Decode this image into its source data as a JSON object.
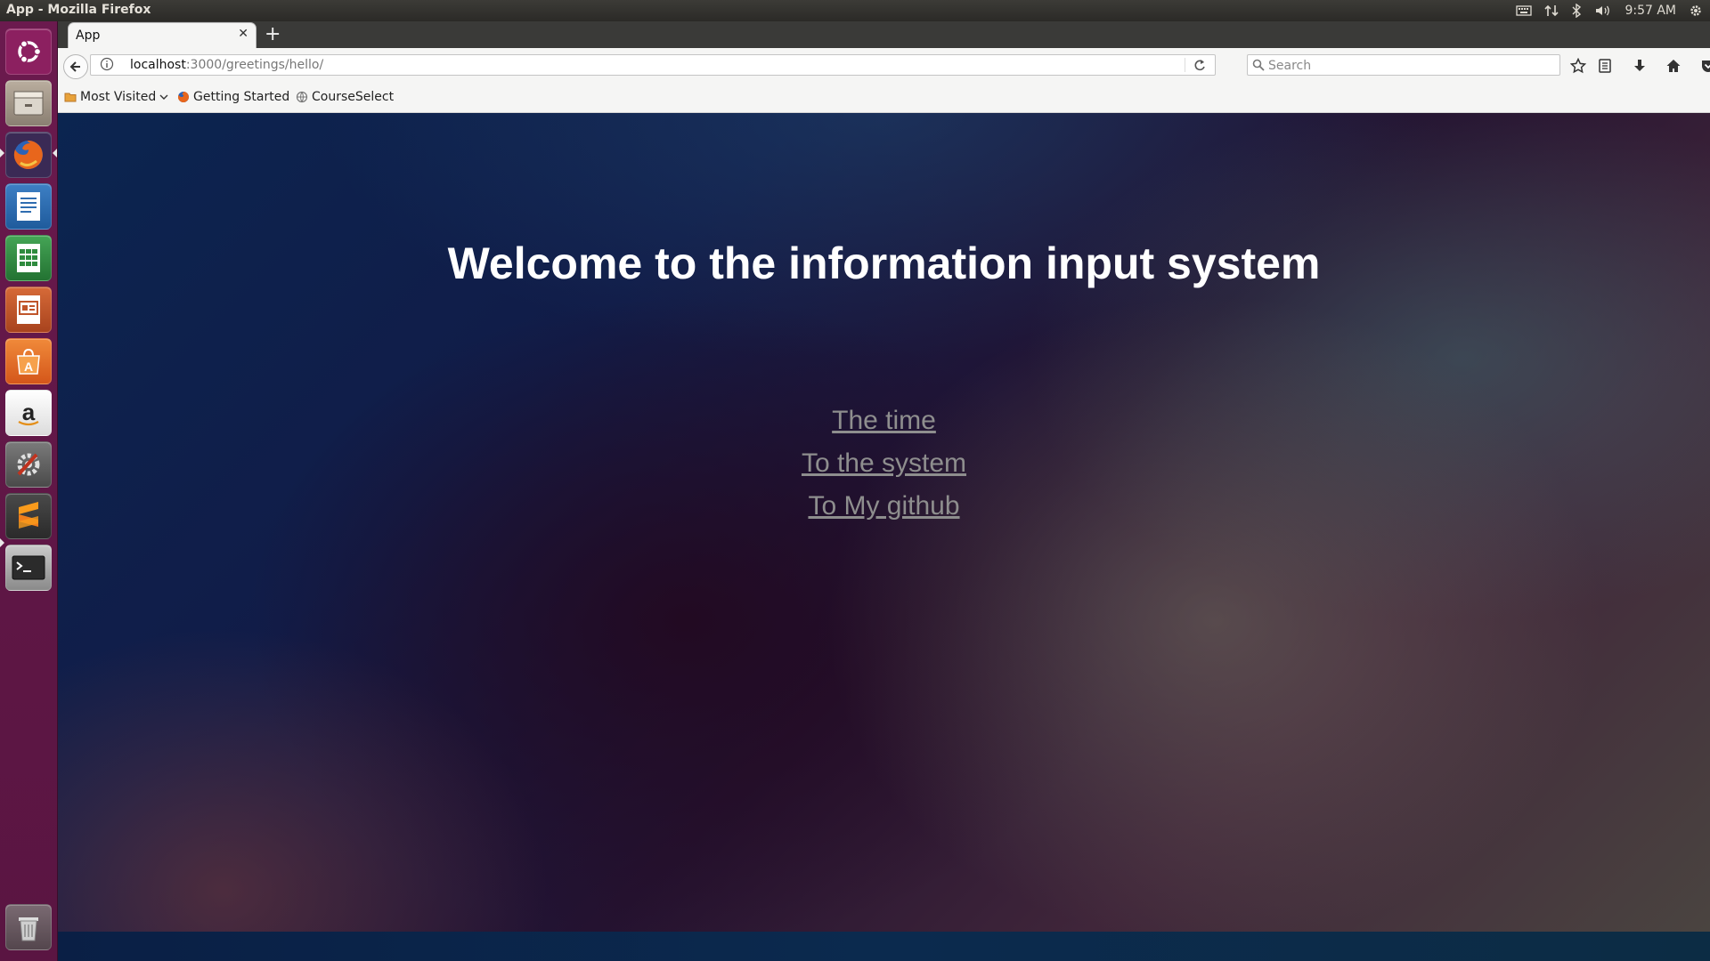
{
  "panel": {
    "window_title": "App - Mozilla Firefox",
    "clock": "9:57 AM"
  },
  "launcher": {
    "items": [
      {
        "name": "ubuntu-dash",
        "icon": "ubuntu-logo-icon",
        "color": "#a8286a"
      },
      {
        "name": "files",
        "icon": "file-manager-icon",
        "color": "#9c8f7e"
      },
      {
        "name": "firefox",
        "icon": "firefox-icon",
        "color": "#d8501c"
      },
      {
        "name": "writer",
        "icon": "libreoffice-writer-icon",
        "color": "#2f6db0"
      },
      {
        "name": "calc",
        "icon": "libreoffice-calc-icon",
        "color": "#2e8b3e"
      },
      {
        "name": "impress",
        "icon": "libreoffice-impress-icon",
        "color": "#c0552a"
      },
      {
        "name": "software-center",
        "icon": "software-center-icon",
        "color": "#e56a1e"
      },
      {
        "name": "amazon",
        "icon": "amazon-icon",
        "color": "#f2f2f2"
      },
      {
        "name": "system-settings",
        "icon": "settings-icon",
        "color": "#b0331f"
      },
      {
        "name": "sublime-text",
        "icon": "sublime-text-icon",
        "color": "#3a3a3a"
      },
      {
        "name": "terminal",
        "icon": "terminal-icon",
        "color": "#2e2e2e"
      },
      {
        "name": "trash",
        "icon": "trash-icon",
        "color": "#6a5a63"
      }
    ]
  },
  "browser": {
    "tab_title": "App",
    "url_host": "localhost",
    "url_path": ":3000/greetings/hello/",
    "search_placeholder": "Search",
    "bookmarks": {
      "most_visited": "Most Visited",
      "getting_started": "Getting Started",
      "course_select": "CourseSelect"
    }
  },
  "page": {
    "heading": "Welcome to the information input system",
    "links": {
      "time": "The time",
      "system": "To the system",
      "github": "To My github"
    }
  }
}
